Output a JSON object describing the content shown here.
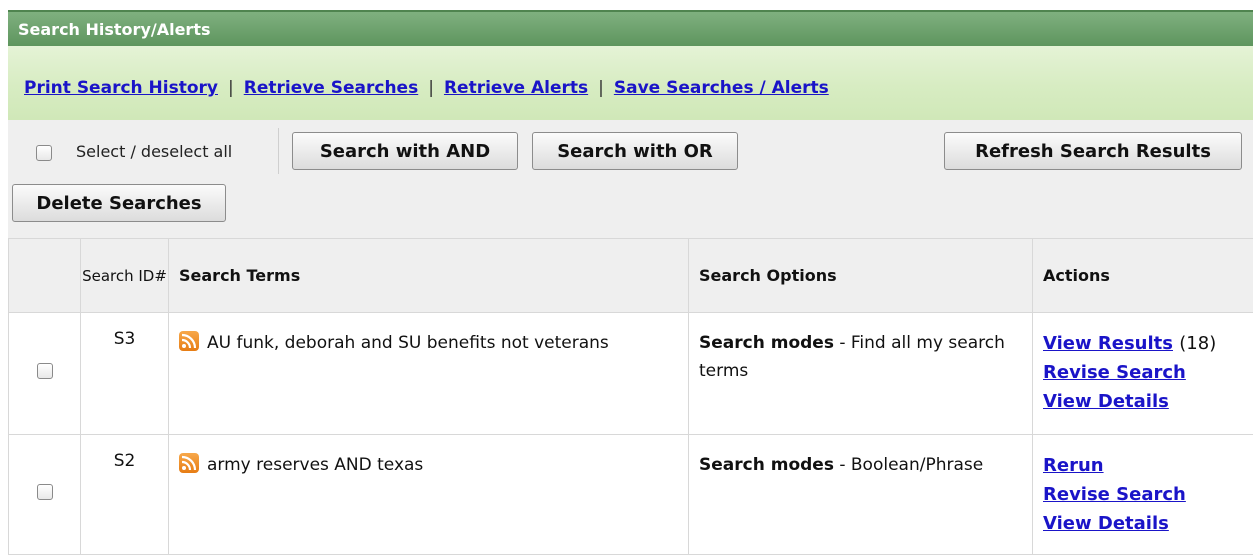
{
  "header": {
    "title": "Search History/Alerts"
  },
  "links": {
    "print": "Print Search History",
    "retrieve_searches": "Retrieve Searches",
    "retrieve_alerts": "Retrieve Alerts",
    "save": "Save Searches / Alerts",
    "separator": "|"
  },
  "toolbar": {
    "select_all_label": "Select / deselect all",
    "search_and": "Search with AND",
    "search_or": "Search with OR",
    "refresh": "Refresh Search Results",
    "delete": "Delete Searches"
  },
  "table": {
    "columns": {
      "id": "Search ID#",
      "terms": "Search Terms",
      "options": "Search Options",
      "actions": "Actions"
    },
    "rows": [
      {
        "id": "S3",
        "terms": "AU funk, deborah and SU benefits not veterans",
        "options_bold": "Search modes",
        "options_rest": " - Find all my search terms",
        "action1": "View Results",
        "count": "(18)",
        "action2": "Revise Search",
        "action3": "View Details"
      },
      {
        "id": "S2",
        "terms": "army reserves AND texas",
        "options_bold": "Search modes",
        "options_rest": " - Boolean/Phrase",
        "action1": "Rerun",
        "action2": "Revise Search",
        "action3": "View Details"
      }
    ]
  },
  "colors": {
    "header_green": "#6a9e6a",
    "link_blue": "#1a14c8",
    "rss_orange": "#ef8f25"
  }
}
